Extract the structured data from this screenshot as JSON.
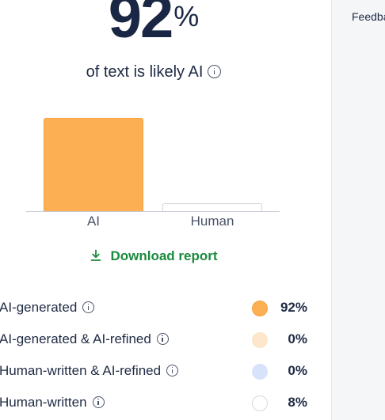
{
  "score": {
    "value": "92",
    "unit": "%"
  },
  "subtitle": "of text is likely AI",
  "chart_data": {
    "type": "bar",
    "categories": [
      "AI",
      "Human"
    ],
    "values": [
      92,
      8
    ],
    "ylim": [
      0,
      92
    ]
  },
  "download": {
    "label": "Download report"
  },
  "breakdown": [
    {
      "label": "AI-generated",
      "value": "92%",
      "color": "#fdb053",
      "border": "#f4a13f"
    },
    {
      "label": "AI-generated & AI-refined",
      "value": "0%",
      "color": "#fde6c9",
      "border": "#fde6c9"
    },
    {
      "label": "Human-written & AI-refined",
      "value": "0%",
      "color": "#d6e3fb",
      "border": "#d6e3fb"
    },
    {
      "label": "Human-written",
      "value": "8%",
      "color": "#ffffff",
      "border": "#d5d9e0"
    }
  ],
  "sidebar": {
    "feedback": "Feedback"
  }
}
